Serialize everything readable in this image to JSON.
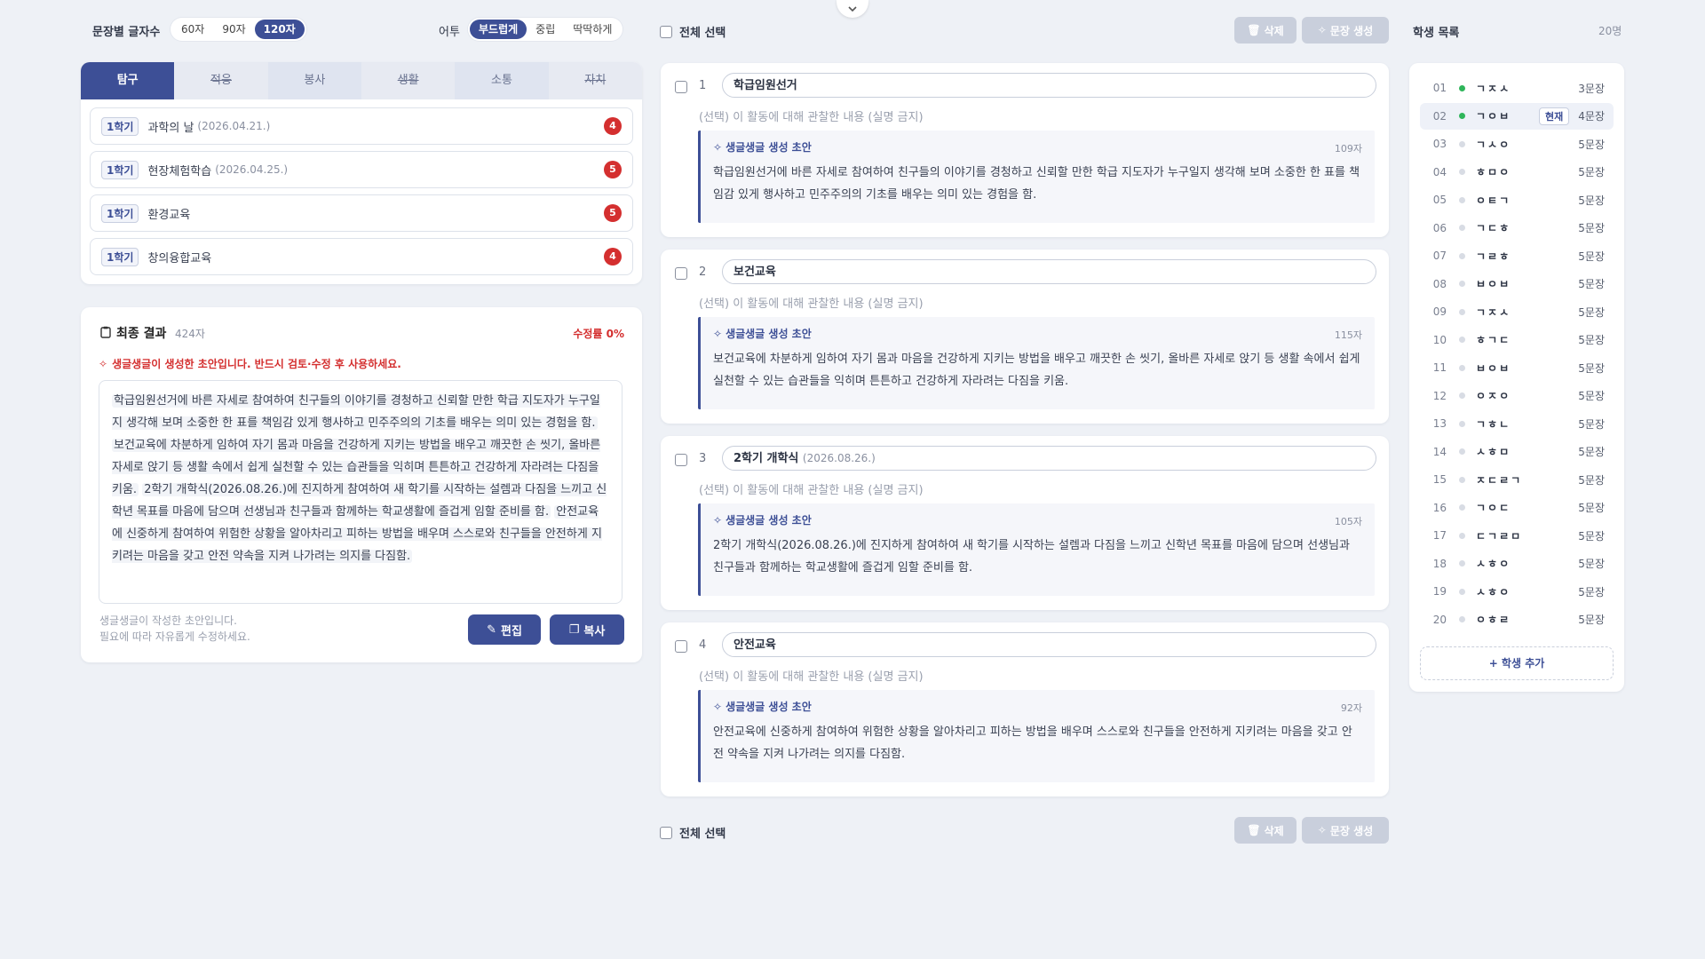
{
  "settings": {
    "length_label": "문장별 글자수",
    "length_options": [
      "60자",
      "90자",
      "120자"
    ],
    "length_selected": 2,
    "tone_label": "어투",
    "tone_options": [
      "부드럽게",
      "중립",
      "딱딱하게"
    ],
    "tone_selected": 0
  },
  "tabs": [
    {
      "label": "탐구",
      "state": "active"
    },
    {
      "label": "적응",
      "state": "strike"
    },
    {
      "label": "봉사",
      "state": "alt"
    },
    {
      "label": "생활",
      "state": "strike"
    },
    {
      "label": "소통",
      "state": "alt"
    },
    {
      "label": "자치",
      "state": "strike"
    }
  ],
  "activities": [
    {
      "semester": "1학기",
      "name": "과학의 날",
      "date": "(2026.04.21.)",
      "count": "4"
    },
    {
      "semester": "1학기",
      "name": "현장체험학습",
      "date": "(2026.04.25.)",
      "count": "5"
    },
    {
      "semester": "1학기",
      "name": "환경교육",
      "date": "",
      "count": "5"
    },
    {
      "semester": "1학기",
      "name": "창의융합교육",
      "date": "",
      "count": "4"
    }
  ],
  "final": {
    "title": "최종 결과",
    "chars": "424자",
    "edit_rate": "수정률 0%",
    "warning": "생글생글이 생성한 초안입니다. 반드시 검토·수정 후 사용하세요.",
    "segments": [
      "학급임원선거에 바른 자세로 참여하여 친구들의 이야기를 경청하고 신뢰할 만한 학급 지도자가 누구일지 생각해 보며 소중한 한 표를 책임감 있게 행사하고 민주주의의 기초를 배우는 의미 있는 경험을 함.",
      "보건교육에 차분하게 임하여 자기 몸과 마음을 건강하게 지키는 방법을 배우고 깨끗한 손 씻기, 올바른 자세로 앉기 등 생활 속에서 쉽게 실천할 수 있는 습관들을 익히며 튼튼하고 건강하게 자라려는 다짐을 키움.",
      "2학기 개학식(2026.08.26.)에 진지하게 참여하여 새 학기를 시작하는 설렘과 다짐을 느끼고 신학년 목표를 마음에 담으며 선생님과 친구들과 함께하는 학교생활에 즐겁게 임할 준비를 함.",
      "안전교육에 신중하게 참여하여 위험한 상황을 알아차리고 피하는 방법을 배우며 스스로와 친구들을 안전하게 지키려는 마음을 갖고 안전 약속을 지켜 나가려는 의지를 다짐함."
    ],
    "note1": "생글생글이 작성한 초안입니다.",
    "note2": "필요에 따라 자유롭게 수정하세요.",
    "edit_label": "편집",
    "copy_label": "복사"
  },
  "middle": {
    "select_all": "전체 선택",
    "delete_label": "삭제",
    "generate_label": "문장 생성",
    "placeholder": "(선택) 이 활동에 대해 관찰한 내용 (실명 금지)",
    "draft_label": "생글생글 생성 초안",
    "sentences": [
      {
        "num": "1",
        "title": "학급임원선거",
        "date": "",
        "chars": "109자",
        "text": "학급임원선거에 바른 자세로 참여하여 친구들의 이야기를 경청하고 신뢰할 만한 학급 지도자가 누구일지 생각해 보며 소중한 한 표를 책임감 있게 행사하고 민주주의의 기초를 배우는 의미 있는 경험을 함."
      },
      {
        "num": "2",
        "title": "보건교육",
        "date": "",
        "chars": "115자",
        "text": "보건교육에 차분하게 임하여 자기 몸과 마음을 건강하게 지키는 방법을 배우고 깨끗한 손 씻기, 올바른 자세로 앉기 등 생활 속에서 쉽게 실천할 수 있는 습관들을 익히며 튼튼하고 건강하게 자라려는 다짐을 키움."
      },
      {
        "num": "3",
        "title": "2학기 개학식",
        "date": "(2026.08.26.)",
        "chars": "105자",
        "text": "2학기 개학식(2026.08.26.)에 진지하게 참여하여 새 학기를 시작하는 설렘과 다짐을 느끼고 신학년 목표를 마음에 담으며 선생님과 친구들과 함께하는 학교생활에 즐겁게 임할 준비를 함."
      },
      {
        "num": "4",
        "title": "안전교육",
        "date": "",
        "chars": "92자",
        "text": "안전교육에 신중하게 참여하여 위험한 상황을 알아차리고 피하는 방법을 배우며 스스로와 친구들을 안전하게 지키려는 마음을 갖고 안전 약속을 지켜 나가려는 의지를 다짐함."
      }
    ]
  },
  "students": {
    "title": "학생 목록",
    "count": "20명",
    "current_tag": "현재",
    "add_label": "+ 학생 추가",
    "list": [
      {
        "no": "01",
        "name": "ㄱㅈㅅ",
        "count": "3문장",
        "done": true
      },
      {
        "no": "02",
        "name": "ㄱㅇㅂ",
        "count": "4문장",
        "done": true,
        "current": true
      },
      {
        "no": "03",
        "name": "ㄱㅅㅇ",
        "count": "5문장"
      },
      {
        "no": "04",
        "name": "ㅎㅁㅇ",
        "count": "5문장"
      },
      {
        "no": "05",
        "name": "ㅇㅌㄱ",
        "count": "5문장"
      },
      {
        "no": "06",
        "name": "ㄱㄷㅎ",
        "count": "5문장"
      },
      {
        "no": "07",
        "name": "ㄱㄹㅎ",
        "count": "5문장"
      },
      {
        "no": "08",
        "name": "ㅂㅇㅂ",
        "count": "5문장"
      },
      {
        "no": "09",
        "name": "ㄱㅈㅅ",
        "count": "5문장"
      },
      {
        "no": "10",
        "name": "ㅎㄱㄷ",
        "count": "5문장"
      },
      {
        "no": "11",
        "name": "ㅂㅇㅂ",
        "count": "5문장"
      },
      {
        "no": "12",
        "name": "ㅇㅈㅇ",
        "count": "5문장"
      },
      {
        "no": "13",
        "name": "ㄱㅎㄴ",
        "count": "5문장"
      },
      {
        "no": "14",
        "name": "ㅅㅎㅁ",
        "count": "5문장"
      },
      {
        "no": "15",
        "name": "ㅈㄷㄹㄱ",
        "count": "5문장"
      },
      {
        "no": "16",
        "name": "ㄱㅇㄷ",
        "count": "5문장"
      },
      {
        "no": "17",
        "name": "ㄷㄱㄹㅁ",
        "count": "5문장"
      },
      {
        "no": "18",
        "name": "ㅅㅎㅇ",
        "count": "5문장"
      },
      {
        "no": "19",
        "name": "ㅅㅎㅇ",
        "count": "5문장"
      },
      {
        "no": "20",
        "name": "ㅇㅎㄹ",
        "count": "5문장"
      }
    ]
  }
}
